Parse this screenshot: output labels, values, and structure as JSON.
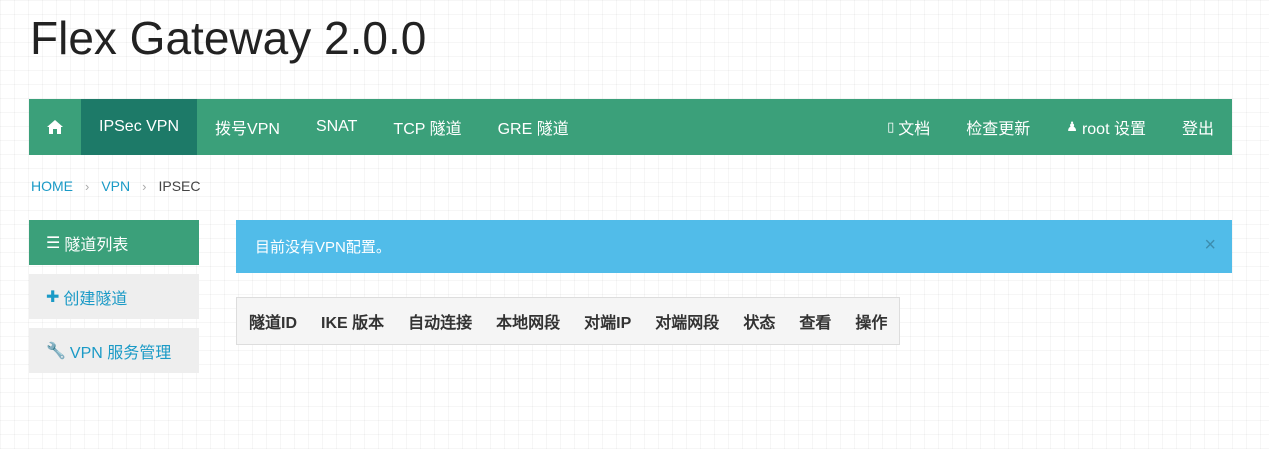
{
  "app": {
    "title": "Flex Gateway 2.0.0"
  },
  "navbar": {
    "home_icon": "home-icon",
    "left_items": [
      {
        "label": "IPSec VPN",
        "active": true
      },
      {
        "label": "拨号VPN",
        "active": false
      },
      {
        "label": "SNAT",
        "active": false
      },
      {
        "label": "TCP 隧道",
        "active": false
      },
      {
        "label": "GRE 隧道",
        "active": false
      }
    ],
    "docs": {
      "icon": "book-icon",
      "glyph": "▯",
      "label": "文档"
    },
    "check_update": {
      "label": "检查更新"
    },
    "settings": {
      "icon": "user-icon",
      "glyph": "♟",
      "label": "root 设置"
    },
    "logout": {
      "label": "登出"
    }
  },
  "breadcrumb": {
    "home": "HOME",
    "vpn": "VPN",
    "current": "IPSEC",
    "separator": "›"
  },
  "sidebar": {
    "items": [
      {
        "icon": "list-icon",
        "glyph": "☰",
        "label": "隧道列表",
        "active": true
      },
      {
        "icon": "plus-icon",
        "glyph": "✚",
        "label": "创建隧道",
        "active": false
      },
      {
        "icon": "wrench-icon",
        "glyph": "🔧",
        "label": "VPN 服务管理",
        "active": false
      }
    ]
  },
  "alert": {
    "message": "目前没有VPN配置。",
    "close_glyph": "×"
  },
  "table": {
    "columns": [
      "隧道ID",
      "IKE 版本",
      "自动连接",
      "本地网段",
      "对端IP",
      "对端网段",
      "状态",
      "查看",
      "操作"
    ]
  },
  "colors": {
    "navbar": "#3ba07a",
    "navbar_active": "#1d7a68",
    "alert": "#51bce9",
    "link": "#1a9ac6",
    "sidebar_inactive": "#eeeeee"
  }
}
